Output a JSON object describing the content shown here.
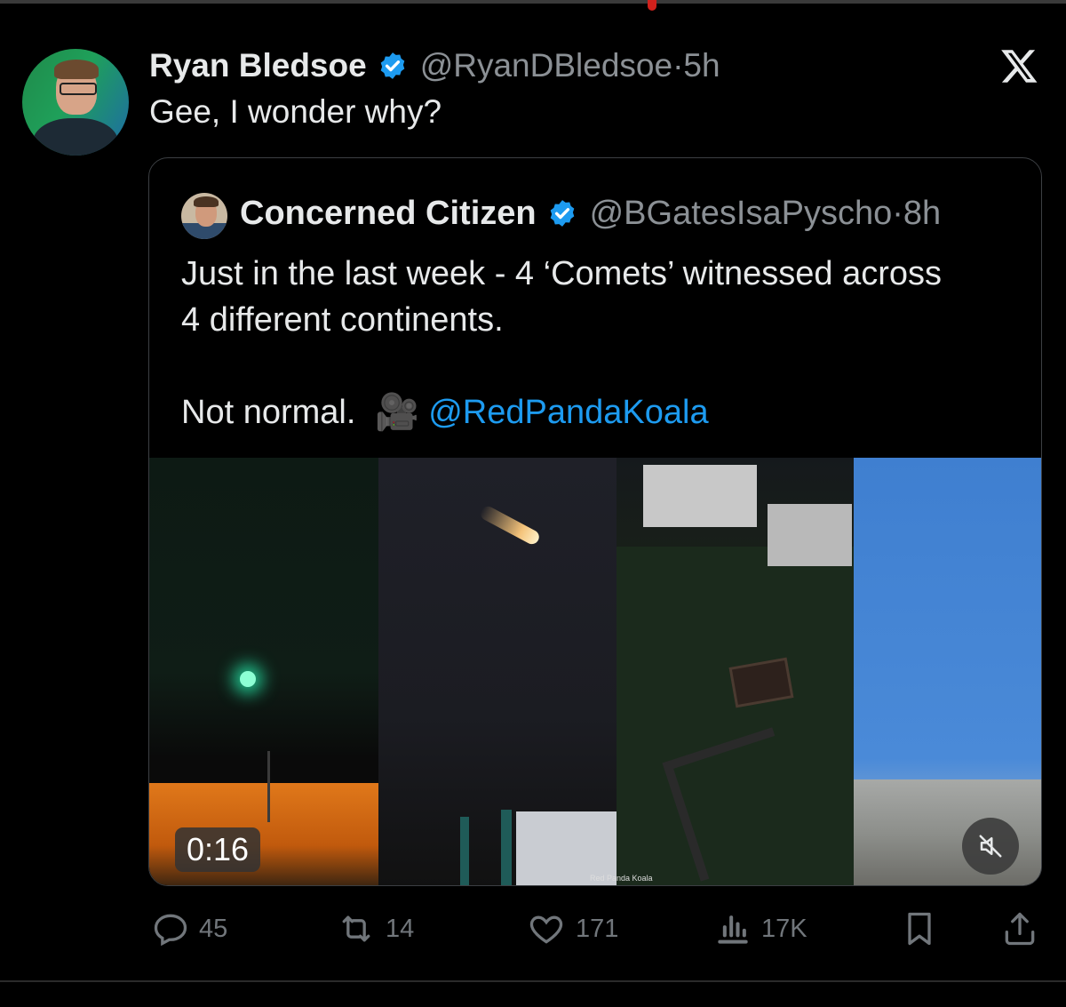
{
  "tweet": {
    "author_name": "Ryan Bledsoe",
    "handle": "@RyanDBledsoe",
    "separator": "·",
    "time": "5h",
    "text": "Gee, I wonder why?",
    "verified": true
  },
  "quoted_tweet": {
    "author_name": "Concerned Citizen",
    "handle": "@BGatesIsaPyscho",
    "separator": "·",
    "time": "8h",
    "verified": true,
    "line1": "Just in the last week - 4 ‘Comets’ witnessed across",
    "line2": "4 different continents.",
    "line3_text": "Not normal.",
    "line3_emoji": "🎥",
    "mention": "@RedPandaKoala",
    "media": {
      "duration": "0:16",
      "watermark": "Red Panda Koala",
      "muted": true
    }
  },
  "actions": {
    "replies": "45",
    "reposts": "14",
    "likes": "171",
    "views": "17K"
  },
  "icons": {
    "close": "x-logo-icon",
    "verified": "verified-badge-icon",
    "reply": "reply-icon",
    "repost": "repost-icon",
    "like": "heart-icon",
    "views": "views-icon",
    "bookmark": "bookmark-icon",
    "share": "share-icon",
    "mute": "muted-speaker-icon"
  },
  "colors": {
    "background": "#000000",
    "text": "#e7e9ea",
    "secondary": "#8b9095",
    "accent": "#1d9bf0"
  }
}
